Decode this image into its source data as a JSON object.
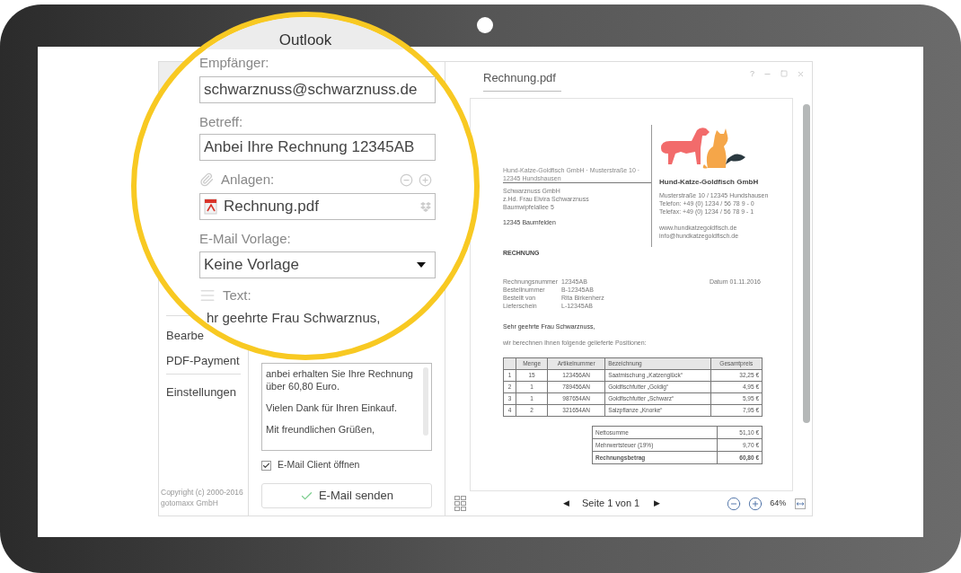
{
  "window": {
    "title": "Outlook",
    "help": "?"
  },
  "sidebar": {
    "groups": [
      {
        "items": [
          {
            "label": "Bearbe"
          },
          {
            "label": "PDF-Payment"
          }
        ]
      },
      {
        "items": [
          {
            "label": "Einstellungen"
          }
        ]
      }
    ],
    "copyright": [
      "Copyright (c) 2000-2016",
      "gotomaxx GmbH"
    ]
  },
  "form": {
    "recipient_label": "Empfänger:",
    "recipient": "schwarznuss@schwarznuss.de",
    "subject_label": "Betreff:",
    "subject": "Anbei Ihre Rechnung 12345AB",
    "attachments_label": "Anlagen:",
    "attachment": "Rechnung.pdf",
    "template_label": "E-Mail Vorlage:",
    "template": "Keine Vorlage",
    "text_label": "Text:",
    "lens_text_line": "hr geehrte Frau Schwarznus,",
    "text_paragraphs": [
      [
        "anbei erhalten Sie Ihre Rechnung",
        "über 60,80 Euro."
      ],
      [
        "Vielen Dank für Ihren Einkauf."
      ],
      [
        "Mit freundlichen Grüßen,"
      ]
    ],
    "open_client": {
      "label": "E-Mail Client öffnen",
      "checked": true
    },
    "send_button": "E-Mail senden"
  },
  "preview": {
    "tab": {
      "label": "Rechnung.pdf",
      "selected": true
    },
    "document": {
      "letterhead": "Hund-Katze-Goldfisch GmbH · Musterstraße 10 · 12345 Hundshausen",
      "recipient_lines": [
        "Schwarznuss GmbH",
        "z.Hd. Frau Elvira Schwarznuss",
        "Baumwipfelallee 5"
      ],
      "recipient_city": "12345 Baumfelden",
      "sender_name": "Hund-Katze-Goldfisch GmbH",
      "sender_lines": [
        "Musterstraße 10 / 12345 Hundshausen",
        "Telefon: +49 (0) 1234 / 56 78 9 - 0",
        "Telefax: +49 (0) 1234 / 56 78 9 - 1"
      ],
      "sender_web": [
        "www.hundkatzegoldfisch.de",
        "info@hundkatzegoldfisch.de"
      ],
      "heading": "RECHNUNG",
      "meta": [
        {
          "label": "Rechnungsnummer",
          "value": "12345AB"
        },
        {
          "label": "Bestellnummer",
          "value": "B-12345AB"
        },
        {
          "label": "Bestellt von",
          "value": "Rita Birkenherz"
        },
        {
          "label": "Lieferschein",
          "value": "L-12345AB"
        }
      ],
      "date": "Datum 01.11.2016",
      "greeting": "Sehr geehrte Frau Schwarznuss,",
      "intro": "wir berechnen Ihnen folgende gelieferte Positionen:",
      "columns": [
        "",
        "Menge",
        "Artikelnummer",
        "Bezeichnung",
        "Gesamtpreis"
      ],
      "rows": [
        [
          "1",
          "15",
          "123456AN",
          "Saatmischung „Katzenglück“",
          "32,25 €"
        ],
        [
          "2",
          "1",
          "789456AN",
          "Goldfischfutter „Goldig“",
          "4,95 €"
        ],
        [
          "3",
          "1",
          "987654AN",
          "Goldfischfutter „Schwarz“",
          "5,95 €"
        ],
        [
          "4",
          "2",
          "321654AN",
          "Salzpflanze „Knorke“",
          "7,95 €"
        ]
      ],
      "totals": [
        {
          "label": "Nettosumme",
          "value": "51,10 €",
          "kind": "sum"
        },
        {
          "label": "Mehrwertsteuer (19%)",
          "value": "9,70 €",
          "kind": "sum"
        },
        {
          "label": "Rechnungsbetrag",
          "value": "60,80 €",
          "kind": "total"
        }
      ]
    },
    "pager": {
      "prev": "◀",
      "label": "Seite 1 von 1",
      "next": "▶"
    },
    "zoom": "64%"
  }
}
